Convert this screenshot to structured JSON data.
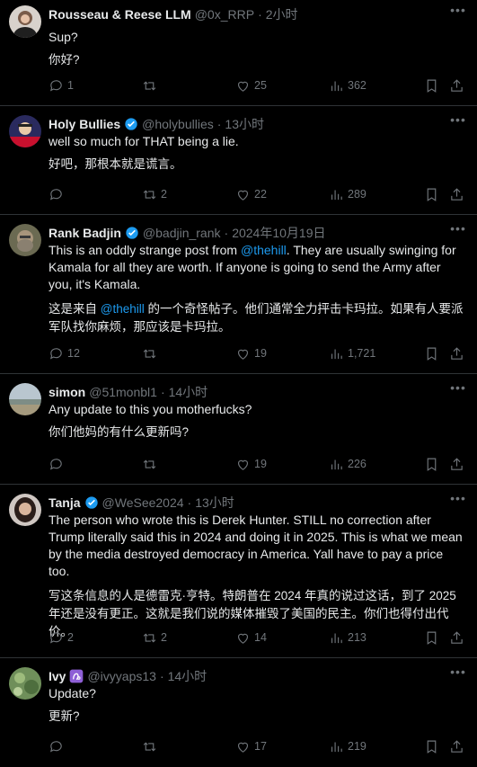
{
  "tweets": [
    {
      "name": "Rousseau & Reese LLM",
      "handle": "@0x_RRP",
      "time": "2小时",
      "text": "Sup?",
      "translation": "你好?",
      "replies": "1",
      "retweets": "",
      "likes": "25",
      "views": "362"
    },
    {
      "name": "Holy Bullies",
      "handle": "@holybullies",
      "time": "13小时",
      "text": "well so much for THAT being a lie.",
      "translation": "好吧，那根本就是谎言。",
      "replies": "",
      "retweets": "2",
      "likes": "22",
      "views": "289"
    },
    {
      "name": "Rank Badjin",
      "handle": "@badjin_rank",
      "time": "2024年10月19日",
      "text_before": "This is an oddly strange post from ",
      "mention": "@thehill",
      "text_after": ". They are usually swinging for Kamala for all they are worth. If anyone is going to send the Army after you, it's Kamala.",
      "translation_before": "这是来自 ",
      "translation_mention": "@thehill",
      "translation_after": " 的一个奇怪帖子。他们通常全力抨击卡玛拉。如果有人要派军队找你麻烦，那应该是卡玛拉。",
      "replies": "12",
      "retweets": "",
      "likes": "19",
      "views": "1,721"
    },
    {
      "name": "simon",
      "handle": "@51monbl1",
      "time": "14小时",
      "text": "Any update to this you motherfucks?",
      "translation": "你们他妈的有什么更新吗?",
      "replies": "",
      "retweets": "",
      "likes": "19",
      "views": "226"
    },
    {
      "name": "Tanja",
      "handle": "@WeSee2024",
      "time": "13小时",
      "text": "The person who wrote this is Derek Hunter. STILL no correction after Trump literally said this in 2024 and doing it in 2025. This is what we mean by the media destroyed democracy in America. Yall have to pay a price too.",
      "translation": "写这条信息的人是德雷克·亨特。特朗普在 2024 年真的说过这话，到了 2025 年还是没有更正。这就是我们说的媒体摧毁了美国的民主。你们也得付出代价。",
      "replies": "2",
      "retweets": "2",
      "likes": "14",
      "views": "213"
    },
    {
      "name": "Ivy",
      "handle": "@ivyyaps13",
      "time": "14小时",
      "text": "Update?",
      "translation": "更新?",
      "replies": "",
      "retweets": "",
      "likes": "17",
      "views": "219"
    }
  ],
  "colors": {
    "background": "#000000",
    "text": "#e7e9ea",
    "muted": "#71767b",
    "accent": "#1d9bf0",
    "divider": "#2f3336"
  },
  "icons": [
    "reply-icon",
    "retweet-icon",
    "like-icon",
    "views-icon",
    "bookmark-icon",
    "share-icon",
    "more-icon",
    "verified-badge-icon",
    "zodiac-badge-icon"
  ]
}
